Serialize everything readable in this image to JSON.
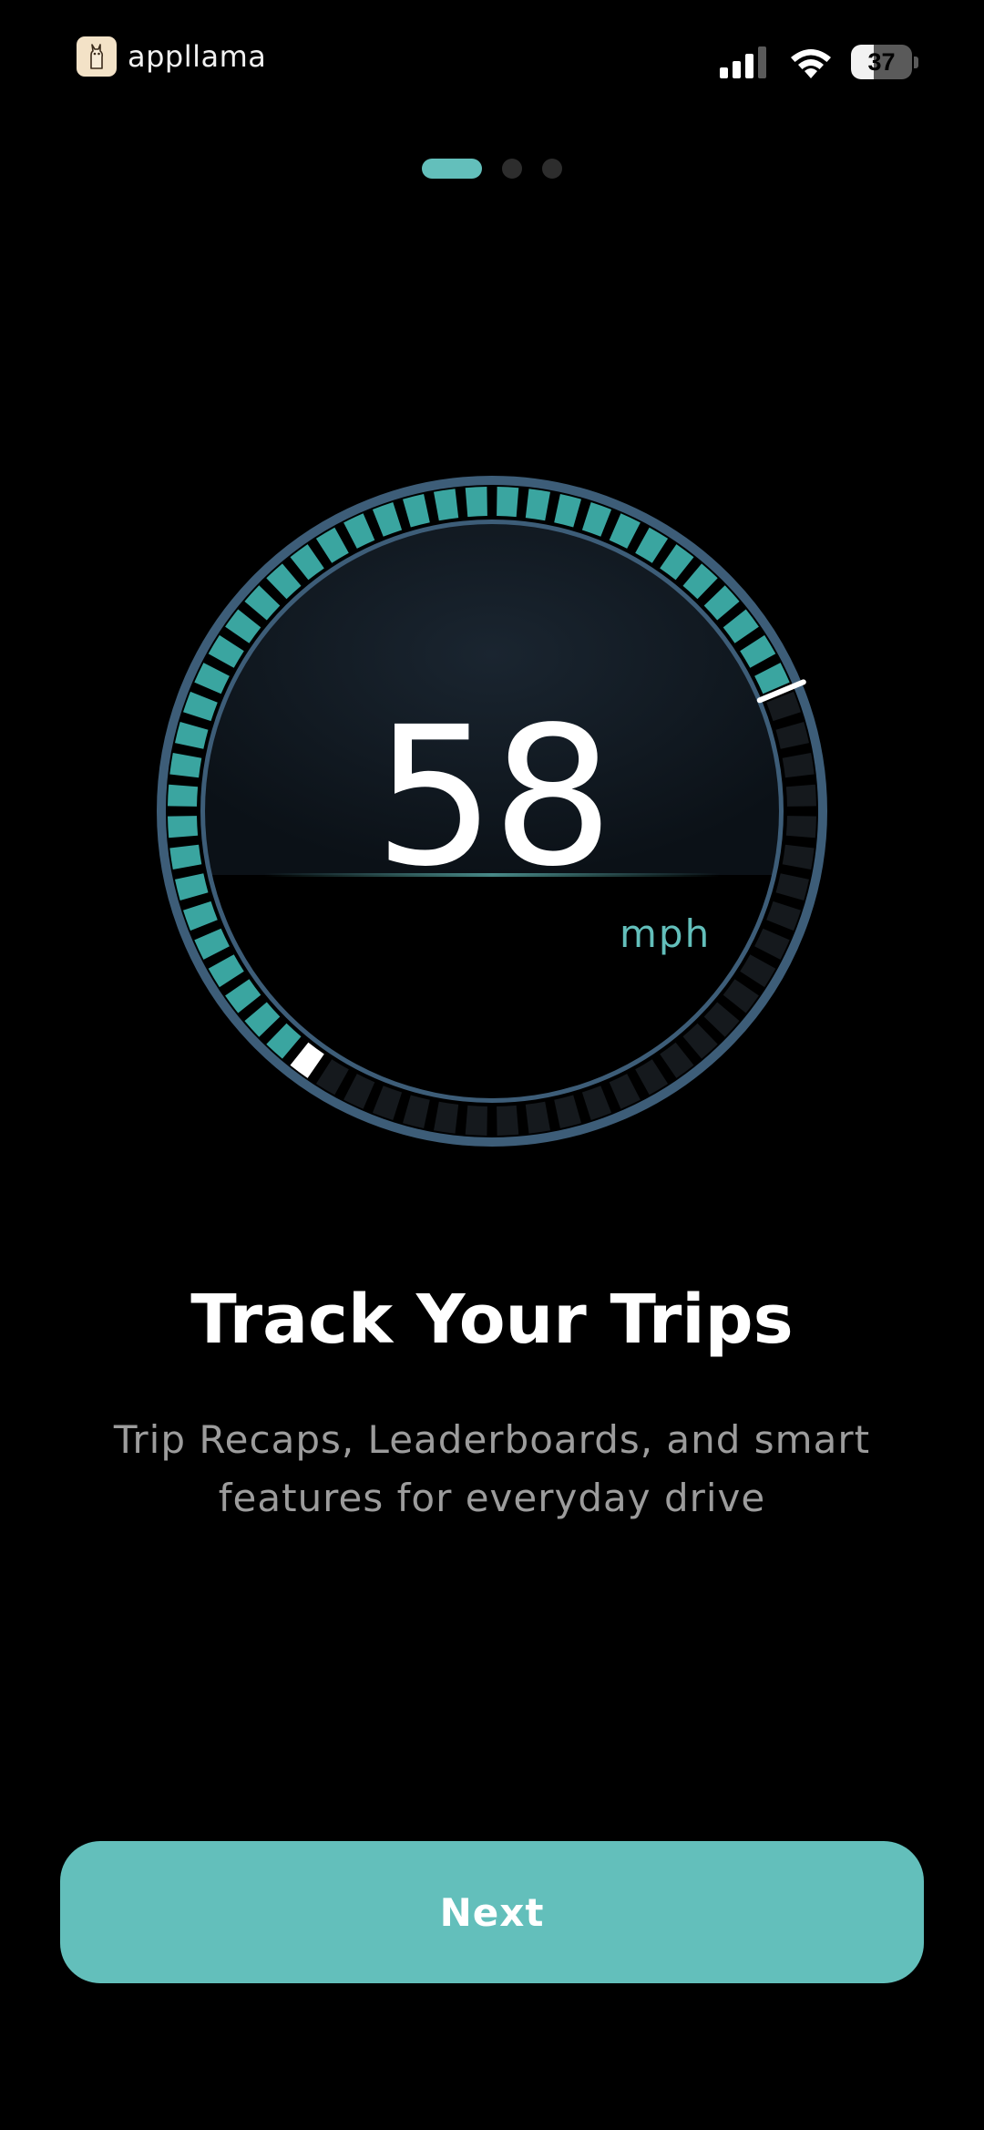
{
  "status_bar": {
    "brand_name": "appllama",
    "brand_icon": "llama-logo-icon",
    "battery_level": 37,
    "battery_text": "37",
    "signal_icon": "cellular-signal-icon",
    "wifi_icon": "wifi-icon"
  },
  "pager": {
    "count": 3,
    "active_index": 0
  },
  "gauge": {
    "speed_value": "58",
    "speed_unit": "mph",
    "segment_count": 64,
    "active_segment_start": 11,
    "active_segment_end": 38,
    "colors": {
      "active_segment": "#3aa5a0",
      "inactive_segment": "#15191d",
      "ring": "#3d5d78",
      "marker": "#ffffff"
    }
  },
  "onboarding": {
    "title": "Track Your Trips",
    "subtitle": "Trip Recaps, Leaderboards, and smart features for everyday drive"
  },
  "actions": {
    "next_label": "Next"
  },
  "colors": {
    "accent": "#63bfbb",
    "background": "#000000",
    "subtitle": "#9c9c9c"
  }
}
